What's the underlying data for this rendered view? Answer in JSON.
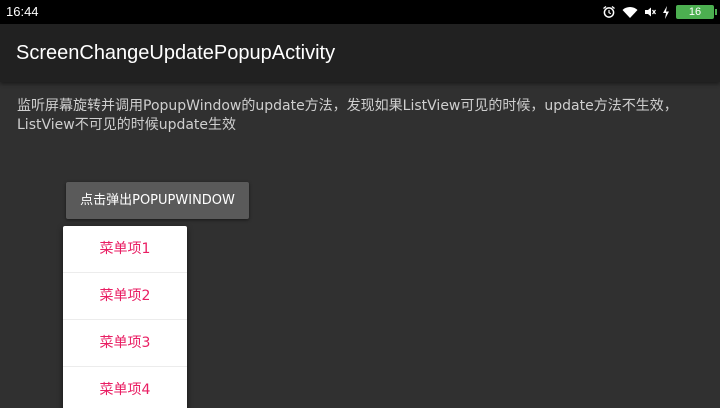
{
  "status_bar": {
    "time": "16:44",
    "battery_level": "16",
    "icons": [
      "alarm-icon",
      "wifi-icon",
      "mute-icon",
      "charging-icon",
      "battery-icon"
    ]
  },
  "app_bar": {
    "title": "ScreenChangeUpdatePopupActivity"
  },
  "content": {
    "description": "监听屏幕旋转并调用PopupWindow的update方法，发现如果ListView可见的时候，update方法不生效，ListView不可见的时候update生效",
    "button_label": "点击弹出POPUPWINDOW"
  },
  "popup_menu": {
    "items": [
      {
        "label": "菜单项1"
      },
      {
        "label": "菜单项2"
      },
      {
        "label": "菜单项3"
      },
      {
        "label": "菜单项4"
      }
    ]
  },
  "colors": {
    "background": "#303030",
    "app_bar": "#212121",
    "button": "#5a5a5a",
    "menu_text": "#e91e63",
    "battery": "#4caf50"
  }
}
